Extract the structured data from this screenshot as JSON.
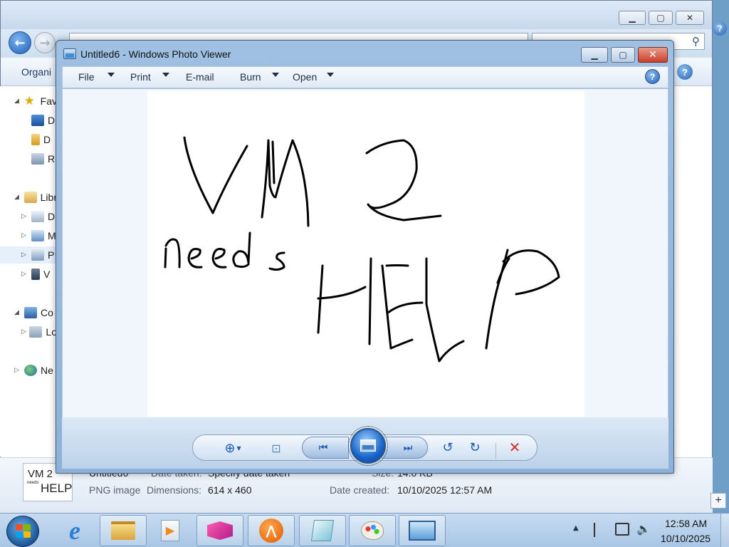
{
  "explorer": {
    "search_placeholder": "",
    "organize_label": "Organi",
    "nav_items": [
      {
        "label": "Fav",
        "icon": "star-icon"
      },
      {
        "label": "D",
        "icon": "desktop-icon"
      },
      {
        "label": "D",
        "icon": "downloads-icon"
      },
      {
        "label": "R",
        "icon": "recent-places-icon"
      },
      {
        "label": "Libr",
        "icon": "libraries-icon"
      },
      {
        "label": "D",
        "icon": "documents-icon"
      },
      {
        "label": "M",
        "icon": "music-icon"
      },
      {
        "label": "P",
        "icon": "pictures-icon"
      },
      {
        "label": "V",
        "icon": "videos-icon"
      },
      {
        "label": "Co",
        "icon": "computer-icon"
      },
      {
        "label": "Lo",
        "icon": "local-disk-icon"
      },
      {
        "label": "Ne",
        "icon": "network-icon"
      }
    ],
    "details": {
      "thumb_text_1": "VM 2",
      "thumb_text_2": "HELP",
      "thumb_text_3": "needs",
      "filename": "Untitled6",
      "date_taken_label": "Date taken:",
      "date_taken_value": "Specify date taken",
      "size_label": "Size:",
      "size_value": "14.0 KB",
      "type": "PNG image",
      "dimensions_label": "Dimensions:",
      "dimensions_value": "614 x 460",
      "date_created_label": "Date created:",
      "date_created_value": "10/10/2025 12:57 AM"
    }
  },
  "viewer": {
    "title": "Untitled6 - Windows Photo Viewer",
    "menu": {
      "file": "File",
      "print": "Print",
      "email": "E-mail",
      "burn": "Burn",
      "open": "Open"
    },
    "help": "?",
    "photo_words": [
      "VM 2",
      "needs",
      "HELP"
    ]
  },
  "taskbar": {
    "time": "12:58 AM",
    "date": "10/10/2025",
    "apps": [
      {
        "icon": "internet-explorer-icon"
      },
      {
        "icon": "windows-explorer-icon"
      },
      {
        "icon": "media-player-icon"
      },
      {
        "icon": "pink-app-icon"
      },
      {
        "icon": "orange-app-icon"
      },
      {
        "icon": "notepad-icon"
      },
      {
        "icon": "paint-icon"
      },
      {
        "icon": "photo-viewer-icon"
      }
    ]
  },
  "colors": {
    "desktop": "#6f9fc7",
    "close_red": "#c9402a",
    "accent_blue": "#1d5bb3"
  }
}
